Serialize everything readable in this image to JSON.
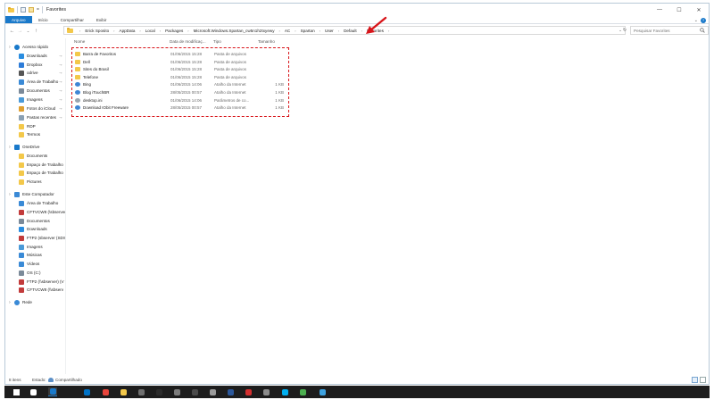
{
  "window": {
    "title": "Favorites",
    "minimize": "—",
    "maximize": "☐",
    "close": "✕"
  },
  "ribbon": {
    "tabs": [
      "Arquivo",
      "Início",
      "Compartilhar",
      "Exibir"
    ],
    "expand": "⌄",
    "help": "?"
  },
  "nav": {
    "back": "←",
    "forward": "→",
    "recent": "⌄",
    "up": "↑"
  },
  "address": {
    "crumbs": [
      "Erick Sposito",
      "AppData",
      "Local",
      "Packages",
      "Microsoft.Windows.Spartan_cw5n1h2txyewy",
      "AC",
      "Spartan",
      "User",
      "Default",
      "Favorites"
    ],
    "separator": "›",
    "dropdown": "⌄",
    "refresh": "↻"
  },
  "search": {
    "placeholder": "Pesquisar Favorites",
    "icon": "search-icon"
  },
  "columns": {
    "name": "Nome",
    "date": "Data de modificaç...",
    "type": "Tipo",
    "size": "Tamanho"
  },
  "files": [
    {
      "name": "Barra de Favoritos",
      "date": "01/06/2015 15:28",
      "type": "Pasta de arquivos",
      "size": "",
      "icon": "folder-icon"
    },
    {
      "name": "Dell",
      "date": "01/06/2015 15:28",
      "type": "Pasta de arquivos",
      "size": "",
      "icon": "folder-icon"
    },
    {
      "name": "Sites do Brasil",
      "date": "01/06/2015 15:28",
      "type": "Pasta de arquivos",
      "size": "",
      "icon": "folder-icon"
    },
    {
      "name": "Telefone",
      "date": "01/06/2015 15:28",
      "type": "Pasta de arquivos",
      "size": "",
      "icon": "folder-icon"
    },
    {
      "name": "Bing",
      "date": "01/06/2015 14:06",
      "type": "Atalho da Internet",
      "size": "1 KB",
      "icon": "internet-shortcut-icon"
    },
    {
      "name": "Blog iTouchBR",
      "date": "28/05/2015 00:57",
      "type": "Atalho da Internet",
      "size": "1 KB",
      "icon": "internet-shortcut-icon"
    },
    {
      "name": "desktop.ini",
      "date": "01/06/2015 14:06",
      "type": "Parâmetros de co...",
      "size": "1 KB",
      "icon": "settings-file-icon"
    },
    {
      "name": "Download IObit Freeware",
      "date": "28/05/2015 00:57",
      "type": "Atalho da Internet",
      "size": "1 KB",
      "icon": "internet-shortcut-icon"
    }
  ],
  "sidebar": {
    "items": [
      {
        "label": "Acesso rápido",
        "icon": "star-icon",
        "level": 0,
        "pinned": false
      },
      {
        "label": "Downloads",
        "icon": "downloads-icon",
        "level": 1,
        "pinned": true
      },
      {
        "label": "Dropbox",
        "icon": "dropbox-icon",
        "level": 1,
        "pinned": true
      },
      {
        "label": "odrive",
        "icon": "odrive-icon",
        "level": 1,
        "pinned": true
      },
      {
        "label": "Área de Trabalho",
        "icon": "desktop-icon",
        "level": 1,
        "pinned": true
      },
      {
        "label": "Documentos",
        "icon": "documents-icon",
        "level": 1,
        "pinned": true
      },
      {
        "label": "Imagens",
        "icon": "pictures-icon",
        "level": 1,
        "pinned": true
      },
      {
        "label": "Fotos do iCloud",
        "icon": "icloud-photos-icon",
        "level": 1,
        "pinned": true
      },
      {
        "label": "Pastas recentes",
        "icon": "recent-folders-icon",
        "level": 1,
        "pinned": true
      },
      {
        "label": "RDP",
        "icon": "folder-icon",
        "level": 1,
        "pinned": false
      },
      {
        "label": "Termos",
        "icon": "folder-icon",
        "level": 1,
        "pinned": false
      },
      {
        "label": "OneDrive",
        "icon": "onedrive-icon",
        "level": 0,
        "pinned": false
      },
      {
        "label": "Documents",
        "icon": "folder-icon",
        "level": 1,
        "pinned": false
      },
      {
        "label": "Espaço de Trabalho",
        "icon": "folder-icon",
        "level": 1,
        "pinned": false
      },
      {
        "label": "Espaço de Trabalho",
        "icon": "folder-icon",
        "level": 1,
        "pinned": false
      },
      {
        "label": "Pictures",
        "icon": "folder-icon",
        "level": 1,
        "pinned": false
      },
      {
        "label": "Este Computador",
        "icon": "computer-icon",
        "level": 0,
        "pinned": false
      },
      {
        "label": "Área de Trabalho",
        "icon": "desktop-icon",
        "level": 1,
        "pinned": false
      },
      {
        "label": "CFTVCW8 (\\sbserver",
        "icon": "network-drive-icon",
        "level": 1,
        "pinned": false
      },
      {
        "label": "Documentos",
        "icon": "documents-icon",
        "level": 1,
        "pinned": false
      },
      {
        "label": "Downloads",
        "icon": "downloads-icon",
        "level": 1,
        "pinned": false
      },
      {
        "label": "FTP2 (sbserver (SDS",
        "icon": "network-drive-icon",
        "level": 1,
        "pinned": false
      },
      {
        "label": "Imagens",
        "icon": "pictures-icon",
        "level": 1,
        "pinned": false
      },
      {
        "label": "Músicas",
        "icon": "music-icon",
        "level": 1,
        "pinned": false
      },
      {
        "label": "Vídeos",
        "icon": "videos-icon",
        "level": 1,
        "pinned": false
      },
      {
        "label": "OS (C:)",
        "icon": "drive-icon",
        "level": 1,
        "pinned": false
      },
      {
        "label": "FTP2 (\\\\sbserver) (V",
        "icon": "network-drive-icon",
        "level": 1,
        "pinned": false
      },
      {
        "label": "CFTVCW8 (\\\\sbserv",
        "icon": "network-drive-icon",
        "level": 1,
        "pinned": false
      },
      {
        "label": "Rede",
        "icon": "network-icon",
        "level": 0,
        "pinned": false
      }
    ]
  },
  "status": {
    "count": "8 itens",
    "state_label": "Estado:",
    "state_value": "Compartilhado",
    "state_icon": "shared-people-icon",
    "view_details_icon": "details-view-icon",
    "view_icons_icon": "large-icons-view-icon"
  },
  "taskbar": {
    "items": [
      {
        "icon": "windows-start-icon",
        "color": "#ffffff"
      },
      {
        "icon": "task-view-icon",
        "color": "#ffffff"
      },
      {
        "icon": "file-explorer-icon",
        "color": "#1979ca"
      },
      {
        "icon": "outlook-icon",
        "color": "#0072c6"
      },
      {
        "icon": "chrome-icon",
        "color": "#e8453c"
      },
      {
        "icon": "folder-icon",
        "color": "#f3c84a"
      },
      {
        "icon": "calculator-icon",
        "color": "#6f6f6f"
      },
      {
        "icon": "terminal-icon",
        "color": "#2b2b2b"
      },
      {
        "icon": "app-icon",
        "color": "#7c7c7c"
      },
      {
        "icon": "app-icon",
        "color": "#4a4a4a"
      },
      {
        "icon": "app-icon",
        "color": "#9a9a9a"
      },
      {
        "icon": "word-icon",
        "color": "#2b579a"
      },
      {
        "icon": "vivaldi-icon",
        "color": "#d32f2f"
      },
      {
        "icon": "app-icon",
        "color": "#8c8c8c"
      },
      {
        "icon": "skype-icon",
        "color": "#00aff0"
      },
      {
        "icon": "chrome-icon",
        "color": "#4caf50"
      },
      {
        "icon": "chat-icon",
        "color": "#3ea2e0"
      }
    ],
    "accent": "#1979ca"
  },
  "colors": {
    "accent": "#1979ca",
    "folder": "#f3c84a",
    "annotation": "#d8151a"
  }
}
